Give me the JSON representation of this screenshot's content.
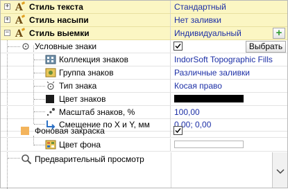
{
  "rows": {
    "text_style": {
      "label": "Стиль текста",
      "value": "Стандартный"
    },
    "embankment_style": {
      "label": "Стиль насыпи",
      "value": "Нет заливки"
    },
    "excavation_style": {
      "label": "Стиль выемки",
      "value": "Индивидуальный"
    },
    "symbols": {
      "label": "Условные знаки",
      "checked": true,
      "button": "Выбрать"
    },
    "symbol_collection": {
      "label": "Коллекция знаков",
      "value": "IndorSoft Topographic Fills"
    },
    "symbol_group": {
      "label": "Группа знаков",
      "value": "Различные заливки"
    },
    "symbol_type": {
      "label": "Тип знака",
      "value": "Косая право"
    },
    "symbol_color": {
      "label": "Цвет знаков",
      "color": "#000000"
    },
    "symbol_scale": {
      "label": "Масштаб знаков, %",
      "value": "100,00"
    },
    "offset": {
      "label": "Смещение по X и Y, мм",
      "value": "0,00; 0,00"
    },
    "background_fill": {
      "label": "Фоновая закраска",
      "checked": true
    },
    "background_color": {
      "label": "Цвет фона",
      "color": "#ffffff"
    },
    "preview": {
      "label": "Предварительный просмотр"
    }
  },
  "add_button": "+",
  "colors": {
    "group_bg": "#fbf6c3",
    "value_text": "#1c2fa6",
    "add_green": "#2e9b2e"
  }
}
